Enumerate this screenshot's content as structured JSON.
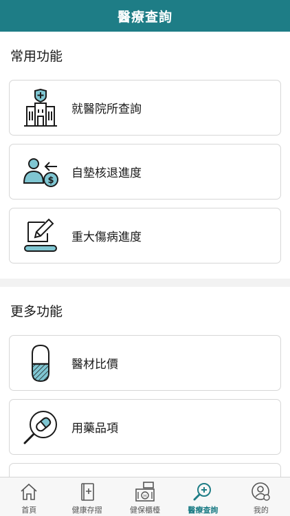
{
  "header": {
    "title": "醫療查詢"
  },
  "sections": [
    {
      "title": "常用功能",
      "items": [
        {
          "label": "就醫院所查詢",
          "icon": "hospital-icon"
        },
        {
          "label": "自墊核退進度",
          "icon": "refund-person-icon"
        },
        {
          "label": "重大傷病進度",
          "icon": "edit-document-icon"
        }
      ]
    },
    {
      "title": "更多功能",
      "items": [
        {
          "label": "醫材比價",
          "icon": "capsule-icon"
        },
        {
          "label": "用藥品項",
          "icon": "pill-search-icon"
        },
        {
          "label": "",
          "icon": "coin-icon"
        }
      ]
    }
  ],
  "tabbar": {
    "items": [
      {
        "label": "首頁",
        "icon": "home-icon"
      },
      {
        "label": "健康存摺",
        "icon": "health-book-icon"
      },
      {
        "label": "健保櫃檯",
        "icon": "counter-icon"
      },
      {
        "label": "醫療查詢",
        "icon": "medical-search-icon",
        "active": true
      },
      {
        "label": "我的",
        "icon": "profile-settings-icon"
      }
    ]
  },
  "colors": {
    "accent": "#1e7d86",
    "icon_fill": "#7fc6d2",
    "icon_stroke": "#1a1a1a"
  }
}
